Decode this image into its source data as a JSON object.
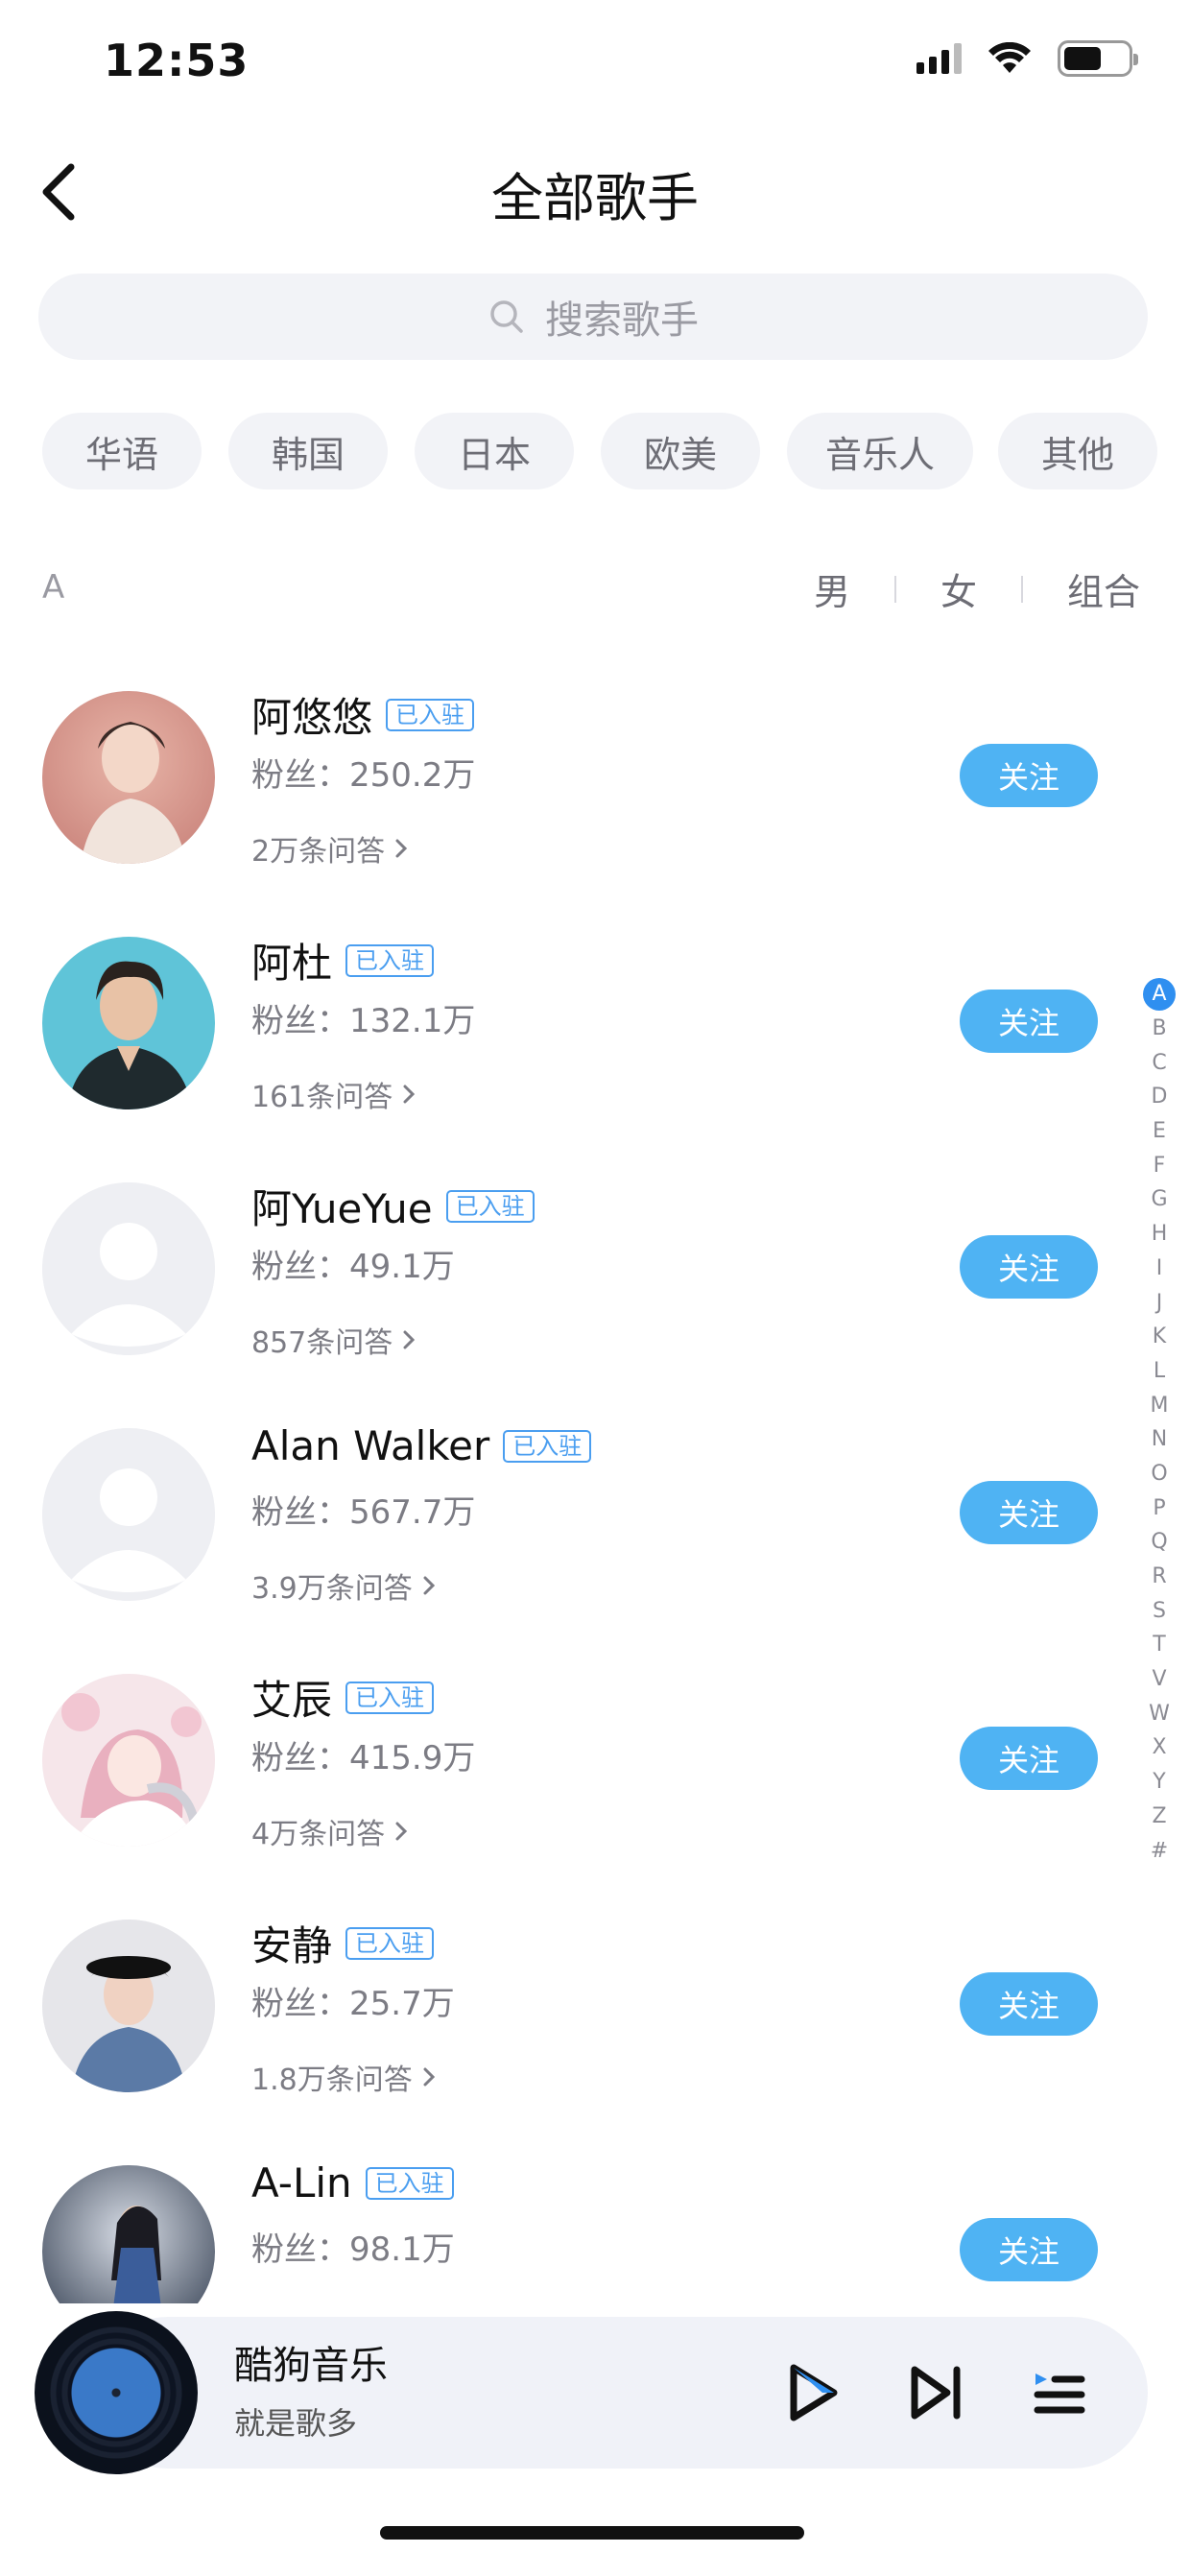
{
  "status_bar": {
    "time": "12:53"
  },
  "header": {
    "title": "全部歌手"
  },
  "search": {
    "placeholder": "搜索歌手"
  },
  "regions": [
    "华语",
    "韩国",
    "日本",
    "欧美",
    "音乐人",
    "其他"
  ],
  "section_letter": "A",
  "gender_filter": [
    "男",
    "女",
    "组合"
  ],
  "artists": [
    {
      "name": "阿悠悠",
      "badge": "已入驻",
      "fans": "粉丝：250.2万",
      "qa": "2万条问答",
      "follow": "关注"
    },
    {
      "name": "阿杜",
      "badge": "已入驻",
      "fans": "粉丝：132.1万",
      "qa": "161条问答",
      "follow": "关注"
    },
    {
      "name": "阿YueYue",
      "badge": "已入驻",
      "fans": "粉丝：49.1万",
      "qa": "857条问答",
      "follow": "关注"
    },
    {
      "name": "Alan Walker",
      "badge": "已入驻",
      "fans": "粉丝：567.7万",
      "qa": "3.9万条问答",
      "follow": "关注"
    },
    {
      "name": "艾辰",
      "badge": "已入驻",
      "fans": "粉丝：415.9万",
      "qa": "4万条问答",
      "follow": "关注"
    },
    {
      "name": "安静",
      "badge": "已入驻",
      "fans": "粉丝：25.7万",
      "qa": "1.8万条问答",
      "follow": "关注"
    },
    {
      "name": "A-Lin",
      "badge": "已入驻",
      "fans": "粉丝：98.1万",
      "qa": "",
      "follow": "关注"
    }
  ],
  "alphabet": [
    "A",
    "B",
    "C",
    "D",
    "E",
    "F",
    "G",
    "H",
    "I",
    "J",
    "K",
    "L",
    "M",
    "N",
    "O",
    "P",
    "Q",
    "R",
    "S",
    "T",
    "V",
    "W",
    "X",
    "Y",
    "Z",
    "#"
  ],
  "alphabet_active": "A",
  "player": {
    "title": "酷狗音乐",
    "subtitle": "就是歌多"
  },
  "colors": {
    "accent": "#4fb3f3",
    "badge": "#4a9ef0",
    "index_active": "#2f8ff0",
    "chip_bg": "#f2f3f7"
  }
}
